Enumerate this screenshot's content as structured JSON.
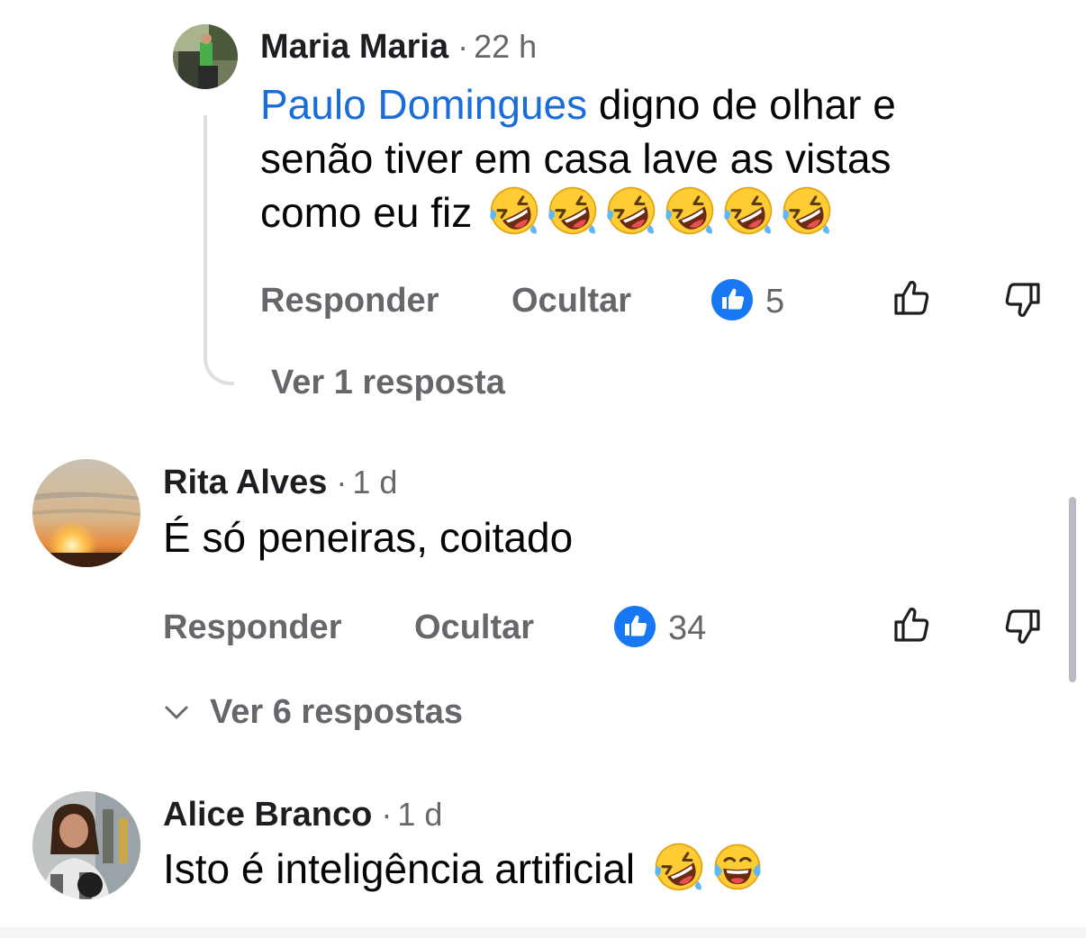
{
  "comments": [
    {
      "author": "Maria Maria",
      "time": "22 h",
      "mention": "Paulo Domingues",
      "text": " digno de olhar e senão tiver em casa lave as vistas como eu fiz",
      "emojis": [
        "rolling-on-floor-laughing",
        "rolling-on-floor-laughing",
        "rolling-on-floor-laughing",
        "rolling-on-floor-laughing",
        "rolling-on-floor-laughing",
        "rolling-on-floor-laughing"
      ],
      "reply_label": "Responder",
      "hide_label": "Ocultar",
      "like_count": "5",
      "replies_label": "Ver 1 resposta"
    },
    {
      "author": "Rita Alves",
      "time": "1 d",
      "text": "É só peneiras, coitado",
      "reply_label": "Responder",
      "hide_label": "Ocultar",
      "like_count": "34",
      "replies_label": "Ver 6 respostas"
    },
    {
      "author": "Alice Branco",
      "time": "1 d",
      "text": "Isto é inteligência artificial",
      "emojis": [
        "rolling-on-floor-laughing",
        "face-with-tears-of-joy"
      ]
    }
  ],
  "icons": {
    "like_badge": "thumbs-up-badge-icon",
    "upvote": "thumbs-up-outline-icon",
    "downvote": "thumbs-down-outline-icon",
    "expand": "chevron-down-icon"
  },
  "colors": {
    "mention": "#1a6dd6",
    "like_badge": "#1877f2",
    "secondary_text": "#65676b"
  }
}
